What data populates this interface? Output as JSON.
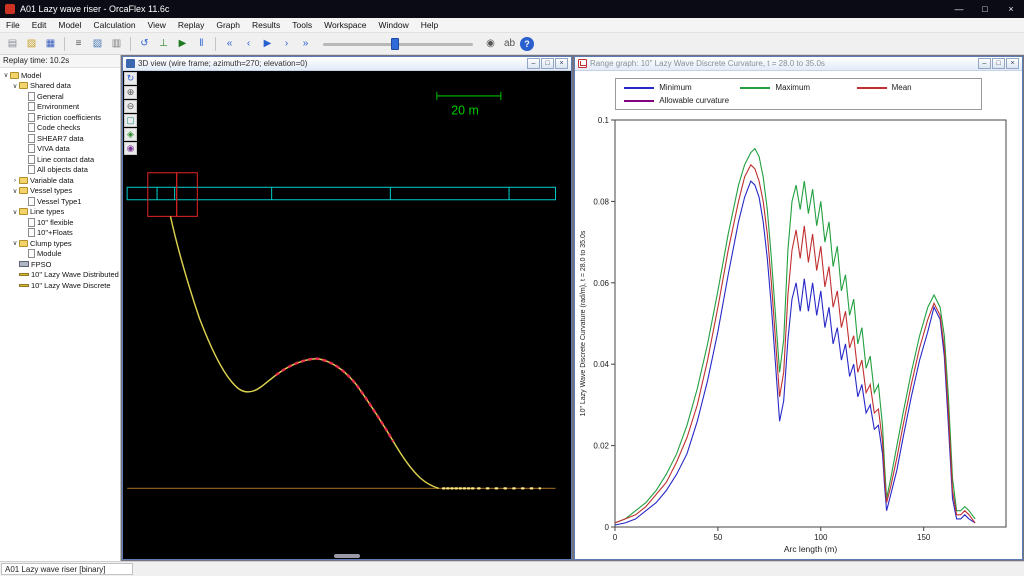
{
  "window": {
    "title": "A01 Lazy wave riser - OrcaFlex 11.6c",
    "controls": {
      "minimize": "—",
      "maximize": "□",
      "close": "×"
    }
  },
  "menu": {
    "items": [
      "File",
      "Edit",
      "Model",
      "Calculation",
      "View",
      "Replay",
      "Graph",
      "Results",
      "Tools",
      "Workspace",
      "Window",
      "Help"
    ]
  },
  "toolbar": {
    "icons": [
      {
        "name": "new-model",
        "glyph": "▤",
        "color": "#8a8a9a"
      },
      {
        "name": "open-model",
        "glyph": "▨",
        "color": "#c9a227"
      },
      {
        "name": "save-model",
        "glyph": "▦",
        "color": "#3a5fbf"
      },
      {
        "sep": true
      },
      {
        "name": "model-browser",
        "glyph": "≡",
        "color": "#555555"
      },
      {
        "name": "new-3d-view",
        "glyph": "▧",
        "color": "#4a7ab5"
      },
      {
        "name": "properties",
        "glyph": "▥",
        "color": "#7a7a7a"
      },
      {
        "sep": true
      },
      {
        "name": "reset-model",
        "glyph": "↺",
        "color": "#2a5fd0"
      },
      {
        "name": "static-analysis",
        "glyph": "⊥",
        "color": "#2a8a2a"
      },
      {
        "name": "run-dynamics",
        "glyph": "▶",
        "color": "#1f7a1f"
      },
      {
        "name": "pause-simulation",
        "glyph": "‖",
        "color": "#2a5fd0"
      },
      {
        "sep": true
      },
      {
        "name": "replay-step-start",
        "glyph": "«",
        "color": "#2a5fd0"
      },
      {
        "name": "replay-step-back",
        "glyph": "‹",
        "color": "#2a5fd0"
      },
      {
        "name": "replay-play",
        "glyph": "▶",
        "color": "#2a5fd0"
      },
      {
        "name": "replay-step-forward",
        "glyph": "›",
        "color": "#2a5fd0"
      },
      {
        "name": "replay-step-end",
        "glyph": "»",
        "color": "#2a5fd0"
      },
      {
        "slider": true,
        "value": 0.45
      },
      {
        "name": "examine-mode",
        "glyph": "◉",
        "color": "#555555"
      },
      {
        "name": "show-labels",
        "glyph": "ab",
        "color": "#555555"
      },
      {
        "name": "help",
        "glyph": "?",
        "color": "#ffffff",
        "bg": "#2a5fd0",
        "round": true
      }
    ]
  },
  "replay": {
    "label": "Replay time: 10.2s"
  },
  "tree": {
    "items": [
      {
        "label": "Model",
        "icon": "folder",
        "depth": 0,
        "expander": "open"
      },
      {
        "label": "Shared data",
        "icon": "folder",
        "depth": 1,
        "expander": "open"
      },
      {
        "label": "General",
        "icon": "doc",
        "depth": 2
      },
      {
        "label": "Environment",
        "icon": "doc",
        "depth": 2
      },
      {
        "label": "Friction coefficients",
        "icon": "doc",
        "depth": 2
      },
      {
        "label": "Code checks",
        "icon": "doc",
        "depth": 2
      },
      {
        "label": "SHEAR7 data",
        "icon": "doc",
        "depth": 2
      },
      {
        "label": "VIVA data",
        "icon": "doc",
        "depth": 2
      },
      {
        "label": "Line contact data",
        "icon": "doc",
        "depth": 2
      },
      {
        "label": "All objects data",
        "icon": "doc",
        "depth": 2
      },
      {
        "label": "Variable data",
        "icon": "folder",
        "depth": 1,
        "expander": "closed"
      },
      {
        "label": "Vessel types",
        "icon": "folder",
        "depth": 1,
        "expander": "open"
      },
      {
        "label": "Vessel Type1",
        "icon": "doc",
        "depth": 2
      },
      {
        "label": "Line types",
        "icon": "folder",
        "depth": 1,
        "expander": "open"
      },
      {
        "label": "10\" flexible",
        "icon": "doc",
        "depth": 2
      },
      {
        "label": "10\"+Floats",
        "icon": "doc",
        "depth": 2
      },
      {
        "label": "Clump types",
        "icon": "folder",
        "depth": 1,
        "expander": "open"
      },
      {
        "label": "Module",
        "icon": "doc",
        "depth": 2
      },
      {
        "label": "FPSO",
        "icon": "vessel",
        "depth": 1
      },
      {
        "label": "10\" Lazy Wave Distributed",
        "icon": "line",
        "depth": 1
      },
      {
        "label": "10\" Lazy Wave Discrete",
        "icon": "line",
        "depth": 1
      }
    ]
  },
  "view3d": {
    "title": "3D view (wire frame; azimuth=270; elevation=0)",
    "scale_label": "20 m",
    "tools": [
      {
        "name": "rotate-view",
        "glyph": "↻",
        "color": "#2a5fd0"
      },
      {
        "name": "zoom-in",
        "glyph": "⊕",
        "color": "#555555"
      },
      {
        "name": "zoom-out",
        "glyph": "⊖",
        "color": "#555555"
      },
      {
        "name": "select-box",
        "glyph": "▢",
        "color": "#1f8a8a"
      },
      {
        "name": "measure",
        "glyph": "◈",
        "color": "#2a8a2a"
      },
      {
        "name": "camera",
        "glyph": "◉",
        "color": "#7a3a9a"
      }
    ],
    "colors": {
      "hull": "#00c8c8",
      "riser": "#ddd24e",
      "floats": "#e83050",
      "seabed": "#8a5a20",
      "scale": "#00cc00",
      "selection": "#dd2222"
    }
  },
  "graph": {
    "title": "Range graph: 10\" Lazy Wave Discrete Curvature, t = 28.0 to 35.0s"
  },
  "chart_data": {
    "type": "line",
    "title": "Range graph: 10\" Lazy Wave Discrete Curvature, t = 28.0 to 35.0s",
    "xlabel": "Arc length (m)",
    "ylabel": "10\" Lazy Wave Discrete Curvature (rad/m), t = 28.0 to 35.0s",
    "xlim": [
      0,
      190
    ],
    "ylim": [
      0,
      0.1
    ],
    "xticks": [
      0,
      50,
      100,
      150
    ],
    "yticks": [
      0,
      0.02,
      0.04,
      0.06,
      0.08,
      0.1
    ],
    "grid": false,
    "legend_position": "top",
    "x": [
      0,
      5,
      10,
      15,
      20,
      25,
      30,
      35,
      40,
      45,
      50,
      55,
      60,
      63,
      66,
      68,
      70,
      72,
      74,
      76,
      78,
      80,
      82,
      84,
      86,
      88,
      90,
      92,
      94,
      96,
      98,
      100,
      102,
      104,
      106,
      108,
      110,
      112,
      114,
      116,
      118,
      120,
      122,
      124,
      126,
      128,
      130,
      131,
      132,
      134,
      137,
      140,
      144,
      148,
      152,
      155,
      158,
      160,
      162,
      164,
      166,
      168,
      170,
      172,
      175
    ],
    "series": [
      {
        "name": "Minimum",
        "color": "#2828c8",
        "values": [
          0.0005,
          0.001,
          0.002,
          0.004,
          0.006,
          0.009,
          0.013,
          0.018,
          0.026,
          0.036,
          0.048,
          0.062,
          0.075,
          0.081,
          0.085,
          0.084,
          0.081,
          0.075,
          0.066,
          0.054,
          0.04,
          0.026,
          0.031,
          0.046,
          0.056,
          0.06,
          0.053,
          0.061,
          0.053,
          0.06,
          0.052,
          0.058,
          0.049,
          0.054,
          0.045,
          0.049,
          0.041,
          0.045,
          0.037,
          0.04,
          0.032,
          0.035,
          0.028,
          0.03,
          0.024,
          0.025,
          0.018,
          0.01,
          0.004,
          0.008,
          0.014,
          0.022,
          0.032,
          0.041,
          0.048,
          0.054,
          0.051,
          0.042,
          0.025,
          0.007,
          0.002,
          0.002,
          0.003,
          0.002,
          0.001
        ]
      },
      {
        "name": "Maximum",
        "color": "#22a040",
        "values": [
          0.001,
          0.002,
          0.004,
          0.006,
          0.009,
          0.013,
          0.018,
          0.025,
          0.034,
          0.045,
          0.058,
          0.072,
          0.084,
          0.089,
          0.092,
          0.093,
          0.091,
          0.086,
          0.078,
          0.066,
          0.052,
          0.038,
          0.046,
          0.068,
          0.08,
          0.084,
          0.078,
          0.085,
          0.077,
          0.083,
          0.074,
          0.08,
          0.07,
          0.075,
          0.064,
          0.069,
          0.058,
          0.062,
          0.052,
          0.056,
          0.045,
          0.049,
          0.039,
          0.042,
          0.033,
          0.035,
          0.025,
          0.015,
          0.007,
          0.012,
          0.02,
          0.028,
          0.038,
          0.047,
          0.054,
          0.057,
          0.054,
          0.047,
          0.032,
          0.012,
          0.004,
          0.004,
          0.005,
          0.004,
          0.002
        ]
      },
      {
        "name": "Mean",
        "color": "#c03030",
        "values": [
          0.001,
          0.002,
          0.003,
          0.005,
          0.008,
          0.011,
          0.016,
          0.022,
          0.03,
          0.041,
          0.054,
          0.068,
          0.08,
          0.086,
          0.089,
          0.088,
          0.085,
          0.08,
          0.072,
          0.06,
          0.046,
          0.032,
          0.038,
          0.057,
          0.068,
          0.073,
          0.066,
          0.074,
          0.065,
          0.072,
          0.063,
          0.069,
          0.059,
          0.064,
          0.054,
          0.058,
          0.049,
          0.053,
          0.044,
          0.047,
          0.038,
          0.041,
          0.033,
          0.035,
          0.028,
          0.029,
          0.021,
          0.012,
          0.006,
          0.01,
          0.017,
          0.025,
          0.035,
          0.044,
          0.051,
          0.055,
          0.052,
          0.044,
          0.028,
          0.009,
          0.003,
          0.003,
          0.004,
          0.003,
          0.001
        ]
      },
      {
        "name": "Allowable curvature",
        "color": "#800080",
        "values": []
      }
    ]
  },
  "statusbar": {
    "text": "A01 Lazy wave riser [binary]"
  }
}
